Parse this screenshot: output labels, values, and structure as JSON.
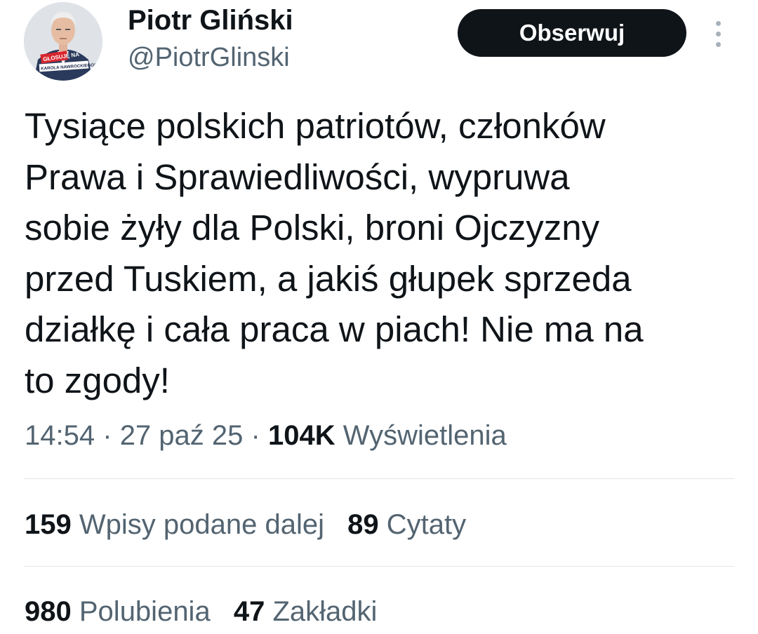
{
  "author": {
    "name": "Piotr Gliński",
    "handle": "@PiotrGlinski",
    "avatar_banner_top": "GŁOSUJĘ NA",
    "avatar_banner_bottom": "KAROLA NAWROCKIEGO!"
  },
  "follow_button": {
    "label": "Obserwuj"
  },
  "tweet": {
    "lines": [
      "Tysiące polskich patriotów, członków",
      "Prawa i Sprawiedliwości, wypruwa",
      "sobie żyły dla Polski, broni Ojczyzny",
      "przed Tuskiem, a jakiś głupek sprzeda",
      "działkę i cała praca w piach! Nie ma na",
      "to zgody!"
    ]
  },
  "meta": {
    "time": "14:54",
    "date": "27 paź 25",
    "views_count": "104K",
    "views_label": "Wyświetlenia",
    "separator": "·"
  },
  "stats": {
    "reposts_count": "159",
    "reposts_label": "Wpisy podane dalej",
    "quotes_count": "89",
    "quotes_label": "Cytaty",
    "likes_count": "980",
    "likes_label": "Polubienia",
    "bookmarks_count": "47",
    "bookmarks_label": "Zakładki"
  },
  "colors": {
    "text_primary": "#0f1419",
    "text_secondary": "#536471",
    "button_bg": "#0f1419",
    "divider": "#e1e6ea"
  }
}
